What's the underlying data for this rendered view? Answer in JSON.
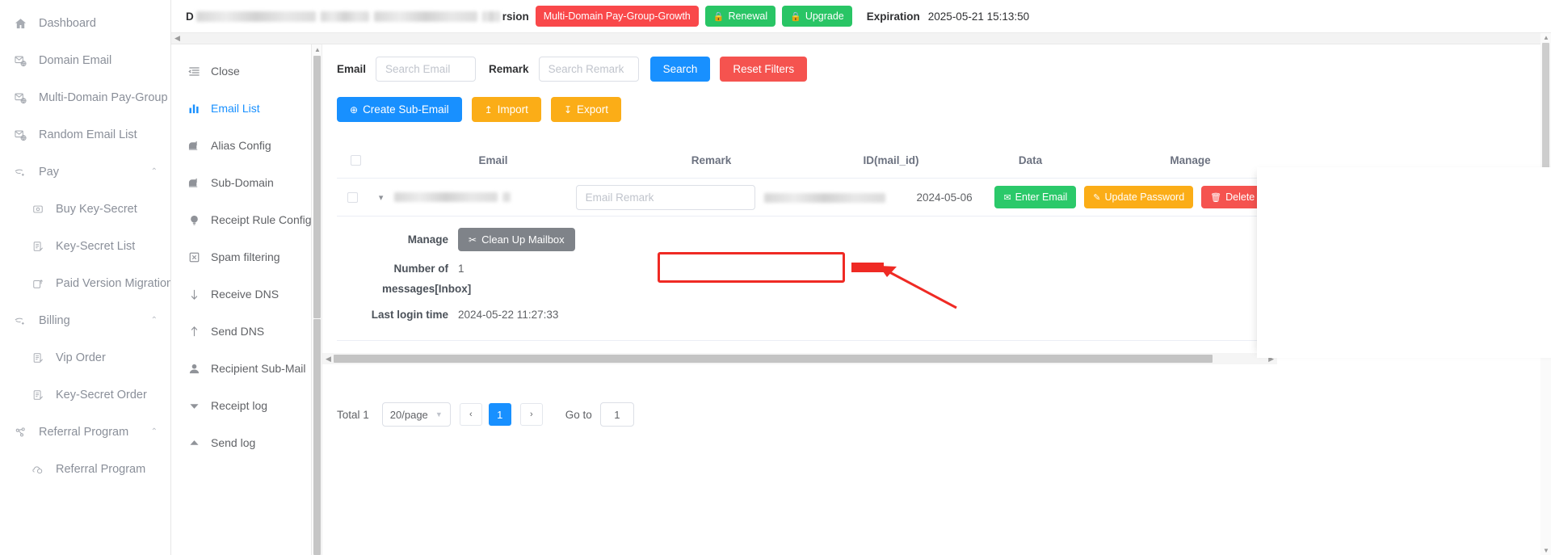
{
  "sidebar": {
    "items": [
      {
        "label": "Dashboard",
        "icon": "home-icon",
        "level": 0,
        "caret": ""
      },
      {
        "label": "Domain Email",
        "icon": "domain-mail-icon",
        "level": 0,
        "caret": ""
      },
      {
        "label": "Multi-Domain Pay-Group",
        "icon": "domain-mail-icon",
        "level": 0,
        "caret": ""
      },
      {
        "label": "Random Email List",
        "icon": "domain-mail-icon",
        "level": 0,
        "caret": ""
      },
      {
        "label": "Pay",
        "icon": "pay-icon",
        "level": 0,
        "caret": "⌃"
      },
      {
        "label": "Buy Key-Secret",
        "icon": "key-icon",
        "level": 1,
        "caret": ""
      },
      {
        "label": "Key-Secret List",
        "icon": "list-icon",
        "level": 1,
        "caret": ""
      },
      {
        "label": "Paid Version Migration",
        "icon": "migration-icon",
        "level": 1,
        "caret": ""
      },
      {
        "label": "Billing",
        "icon": "pay-icon",
        "level": 0,
        "caret": "⌃"
      },
      {
        "label": "Vip Order",
        "icon": "list-icon",
        "level": 1,
        "caret": ""
      },
      {
        "label": "Key-Secret Order",
        "icon": "list-icon",
        "level": 1,
        "caret": ""
      },
      {
        "label": "Referral Program",
        "icon": "share-icon",
        "level": 0,
        "caret": "⌃"
      },
      {
        "label": "Referral Program",
        "icon": "referral-icon",
        "level": 1,
        "caret": ""
      }
    ]
  },
  "topbar": {
    "prefix_text": "D",
    "version_label_tail": "rsion",
    "plan_badge": "Multi-Domain Pay-Group-Growth",
    "renewal_label": "Renewal",
    "upgrade_label": "Upgrade",
    "expiration_label": "Expiration",
    "expiration_value": "2025-05-21 15:13:50",
    "colors": {
      "plan": "#f9484a",
      "action": "#29c565"
    }
  },
  "submenu": {
    "items": [
      {
        "label": "Close",
        "icon": "collapse-icon",
        "active": false
      },
      {
        "label": "Email List",
        "icon": "bar-chart-icon",
        "active": true
      },
      {
        "label": "Alias Config",
        "icon": "mailbox-icon",
        "active": false
      },
      {
        "label": "Sub-Domain",
        "icon": "mailbox-icon",
        "active": false
      },
      {
        "label": "Receipt Rule Config",
        "icon": "bulb-icon",
        "active": false
      },
      {
        "label": "Spam filtering",
        "icon": "spam-icon",
        "active": false
      },
      {
        "label": "Receive DNS",
        "icon": "arrow-down-icon",
        "active": false
      },
      {
        "label": "Send DNS",
        "icon": "arrow-up-icon",
        "active": false
      },
      {
        "label": "Recipient Sub-Mail",
        "icon": "user-icon",
        "active": false
      },
      {
        "label": "Receipt log",
        "icon": "triangle-down-icon",
        "active": false
      },
      {
        "label": "Send log",
        "icon": "triangle-up-icon",
        "active": false
      }
    ]
  },
  "filters": {
    "email_label": "Email",
    "email_placeholder": "Search Email",
    "email_value": "",
    "remark_label": "Remark",
    "remark_placeholder": "Search Remark",
    "remark_value": "",
    "search_button": "Search",
    "reset_button": "Reset Filters"
  },
  "actions": {
    "create": "Create Sub-Email",
    "import": "Import",
    "export": "Export"
  },
  "table": {
    "headers": [
      "",
      "Email",
      "Remark",
      "ID(mail_id)",
      "Data",
      "Manage"
    ],
    "rows": [
      {
        "email": "",
        "remark_placeholder": "Email Remark",
        "remark_value": "",
        "mail_id": "",
        "date": "2024-05-06",
        "manage": [
          {
            "label": "Enter Email",
            "style": "green",
            "icon": "envelope-icon"
          },
          {
            "label": "Update Password",
            "style": "orange",
            "icon": "pencil-icon"
          },
          {
            "label": "Delete Email",
            "style": "red",
            "icon": "trash-icon"
          }
        ]
      }
    ]
  },
  "detail": {
    "manage_label": "Manage",
    "cleanup_button": "Clean Up Mailbox",
    "cleanup_icon": "scissors-icon",
    "number_label": "Number of",
    "number_value": "1",
    "messages_label": "messages[Inbox]",
    "last_login_label": "Last login time",
    "last_login_value": "2024-05-22 11:27:33",
    "highlight_color": "#ef2a24"
  },
  "pagination": {
    "total_label": "Total 1",
    "page_size": "20/page",
    "prev": "‹",
    "current_page": "1",
    "next": "›",
    "goto_label": "Go to",
    "goto_value": "1"
  }
}
